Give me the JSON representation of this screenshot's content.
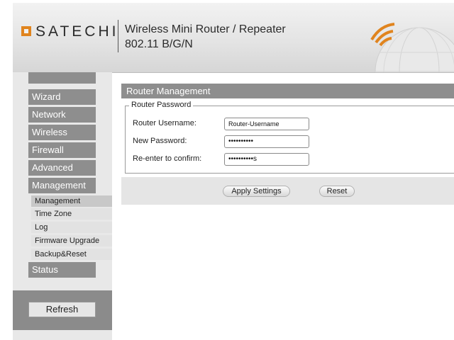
{
  "header": {
    "brand": "SATECHI",
    "product_name": "Wireless Mini Router / Repeater",
    "product_standard": "802.11 B/G/N",
    "colors": {
      "brand_orange": "#e0841e",
      "nav_gray": "#8e8e8e"
    },
    "icons": {
      "logo": "satechi-logo-icon",
      "globe": "globe-wifi-icon"
    }
  },
  "sidebar": {
    "items": [
      {
        "label": "Wizard"
      },
      {
        "label": "Network"
      },
      {
        "label": "Wireless"
      },
      {
        "label": "Firewall"
      },
      {
        "label": "Advanced"
      },
      {
        "label": "Management"
      }
    ],
    "sub_items": [
      {
        "label": "Management",
        "active": true
      },
      {
        "label": "Time Zone"
      },
      {
        "label": "Log"
      },
      {
        "label": "Firmware Upgrade"
      },
      {
        "label": "Backup&Reset"
      }
    ],
    "status_label": "Status",
    "refresh_label": "Refresh"
  },
  "main": {
    "title": "Router Management",
    "section": "Router Password",
    "fields": {
      "username_label": "Router Username:",
      "username_value": "Router-Username",
      "new_password_label": "New Password:",
      "new_password_value": "••••••••••",
      "confirm_label": "Re-enter to confirm:",
      "confirm_value": "••••••••••s"
    },
    "apply_label": "Apply Settings",
    "reset_label": "Reset"
  }
}
